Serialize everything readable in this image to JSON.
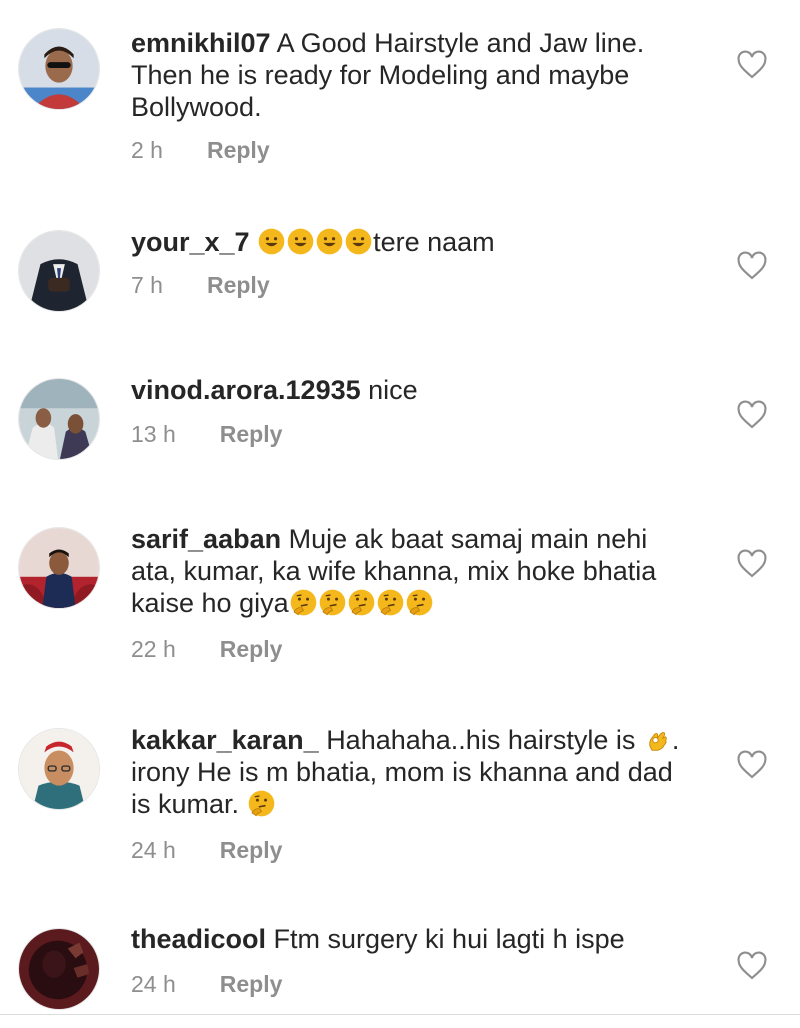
{
  "comments": [
    {
      "username": "emnikhil07",
      "text": "A Good Hairstyle and Jaw line.",
      "text2": "Then he is ready for Modeling and maybe",
      "text3": "Bollywood.",
      "time": "2 h",
      "reply": "Reply"
    },
    {
      "username": "your_x_7",
      "emojis": [
        "smile-emoji",
        "smile-emoji",
        "smile-emoji",
        "smile-emoji"
      ],
      "text": "tere naam",
      "time": "7 h",
      "reply": "Reply"
    },
    {
      "username": "vinod.arora.12935",
      "text": "nice",
      "time": "13 h",
      "reply": "Reply"
    },
    {
      "username": "sarif_aaban",
      "text": "Muje ak baat samaj main nehi",
      "text2": "ata, kumar,  ka wife khanna,  mix hoke bhatia",
      "text3": "kaise ho giya",
      "emojis": [
        "thinking-emoji",
        "thinking-emoji",
        "thinking-emoji",
        "thinking-emoji",
        "thinking-emoji"
      ],
      "time": "22 h",
      "reply": "Reply"
    },
    {
      "username": "kakkar_karan_",
      "text": "Hahahaha..his hairstyle is",
      "emoji_mid": "ok-hand-emoji",
      "text_after": ".",
      "text2": "irony He is m bhatia, mom is khanna and dad",
      "text3": "is kumar.",
      "emoji_end": "thinking-emoji",
      "time": "24 h",
      "reply": "Reply"
    },
    {
      "username": "theadicool",
      "text": "Ftm surgery ki hui lagti h ispe",
      "time": "24 h",
      "reply": "Reply"
    }
  ],
  "colors": {
    "text": "#262626",
    "meta": "#8e8e8e",
    "emoji": "#f5b81c"
  },
  "icons": {
    "like": "heart-outline-icon"
  }
}
